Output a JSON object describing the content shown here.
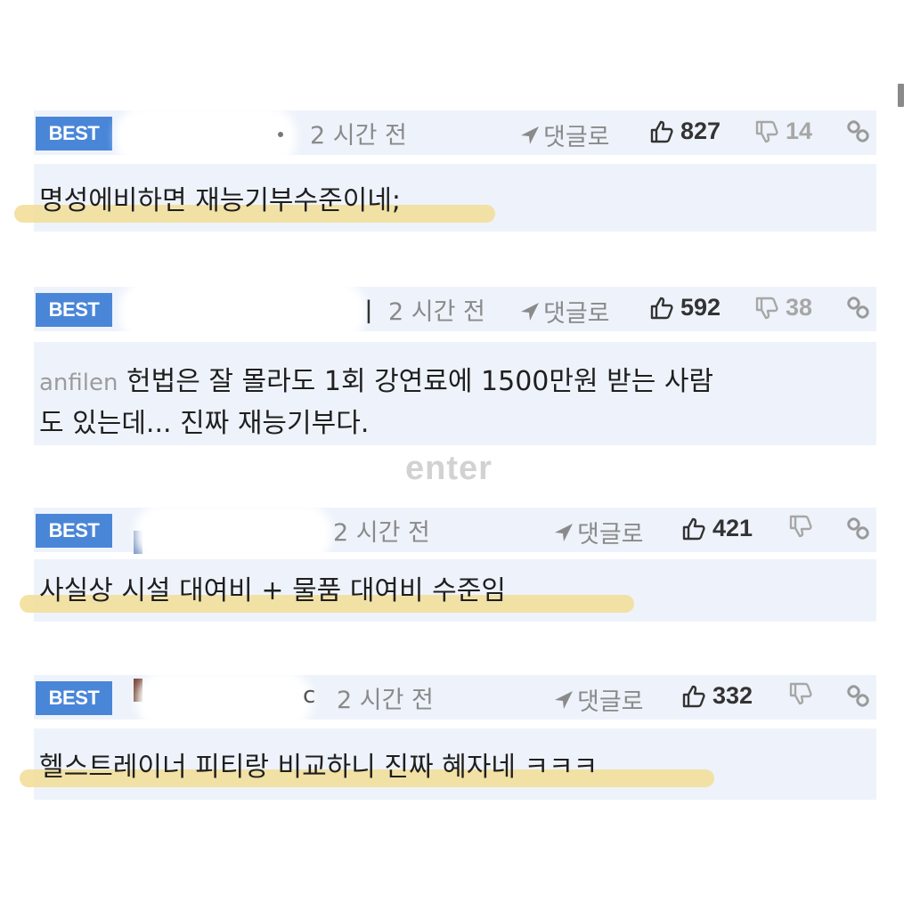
{
  "scrollbar": true,
  "watermark": "enter",
  "comments": [
    {
      "badge": "BEST",
      "time": "2 시간 전",
      "reply_label": "댓글로",
      "likes": "827",
      "dislikes": "14",
      "text": "명성에비하면 재능기부수준이네;"
    },
    {
      "badge": "BEST",
      "author_fragment": "ㅣ",
      "time": "2 시간 전",
      "reply_label": "댓글로",
      "likes": "592",
      "dislikes": "38",
      "text_prefix": "anfilen",
      "text_line1": "헌법은 잘 몰라도 1회 강연료에 1500만원 받는 사람",
      "text_line2": "도 있는데... 진짜 재능기부다."
    },
    {
      "badge": "BEST",
      "time": "2 시간 전",
      "reply_label": "댓글로",
      "likes": "421",
      "dislikes": "",
      "text": "사실상 시설 대여비 + 물품 대여비 수준임"
    },
    {
      "badge": "BEST",
      "author_fragment": "c",
      "time": "2 시간 전",
      "reply_label": "댓글로",
      "likes": "332",
      "dislikes": "",
      "text": "헬스트레이너 피티랑 비교하니 진짜 혜자네 ㅋㅋㅋ"
    }
  ],
  "colors": {
    "badge": "#4a86d8",
    "card_bg": "#eef3fb",
    "highlight": "#f2dd95",
    "muted": "#8a8a8a"
  }
}
